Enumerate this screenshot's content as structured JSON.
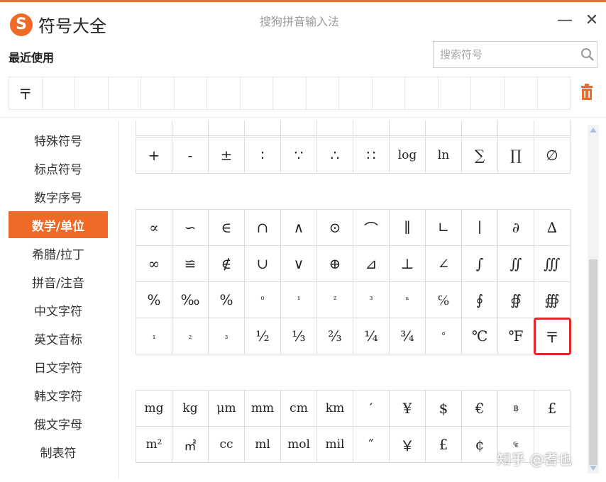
{
  "window": {
    "title": "符号大全",
    "app_name": "搜狗拼音输入法",
    "logo_letter": "S",
    "minimize": "—",
    "close": "✕",
    "accent": "#ef6a26"
  },
  "recent": {
    "label": "最近使用",
    "items": [
      "〒",
      "",
      "",
      "",
      "",
      "",
      "",
      "",
      "",
      "",
      "",
      "",
      "",
      "",
      "",
      "",
      ""
    ]
  },
  "search": {
    "placeholder": "搜索符号"
  },
  "sidebar": {
    "items": [
      {
        "label": "特殊符号",
        "active": false
      },
      {
        "label": "标点符号",
        "active": false
      },
      {
        "label": "数字序号",
        "active": false
      },
      {
        "label": "数学/单位",
        "active": true
      },
      {
        "label": "希腊/拉丁",
        "active": false
      },
      {
        "label": "拼音/注音",
        "active": false
      },
      {
        "label": "中文字符",
        "active": false
      },
      {
        "label": "英文音标",
        "active": false
      },
      {
        "label": "日文字符",
        "active": false
      },
      {
        "label": "韩文字符",
        "active": false
      },
      {
        "label": "俄文字母",
        "active": false
      },
      {
        "label": "制表符",
        "active": false
      }
    ]
  },
  "symbols": {
    "group1": [
      [
        "+",
        "-",
        "±",
        "∶",
        "∵",
        "∴",
        "∷",
        "log",
        "ln",
        "∑",
        "∏",
        "∅"
      ]
    ],
    "group2": [
      [
        "∝",
        "∽",
        "∈",
        "∩",
        "∧",
        "⊙",
        "⌒",
        "∥",
        "∟",
        "∣",
        "∂",
        "∆"
      ],
      [
        "∞",
        "≌",
        "∉",
        "∪",
        "∨",
        "⊕",
        "⊿",
        "⊥",
        "∠",
        "∫",
        "∬",
        "∭"
      ],
      [
        "%",
        "‰",
        "%",
        "⁰",
        "¹",
        "²",
        "³",
        "ⁿ",
        "℅",
        "∮",
        "∯",
        "∰"
      ],
      [
        "₁",
        "₂",
        "₃",
        "½",
        "⅓",
        "⅔",
        "¼",
        "¾",
        "°",
        "℃",
        "℉",
        "〒"
      ]
    ],
    "group3": [
      [
        "mg",
        "kg",
        "μm",
        "mm",
        "cm",
        "km",
        "′",
        "¥",
        "$",
        "€",
        "฿",
        "£"
      ],
      [
        "m²",
        "㎡",
        "cc",
        "ml",
        "mol",
        "mil",
        "″",
        "￥",
        "£",
        "¢",
        "₠",
        ""
      ]
    ],
    "highlighted": "〒"
  },
  "watermark": "知乎 @耆也"
}
